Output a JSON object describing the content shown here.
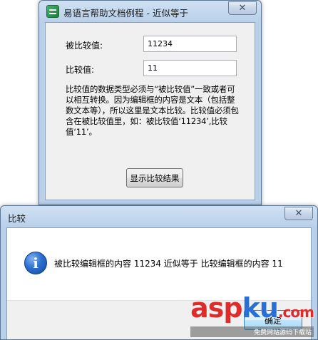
{
  "main_window": {
    "title": "易语言帮助文档例程 - 近似等于",
    "close_glyph": "✕",
    "label_compared": "被比较值:",
    "value_compared": "11234",
    "label_compare": "比较值:",
    "value_compare": "11",
    "description": "比较值的数据类型必须与“被比较值”一致或者可以相互转换。因为编辑框的内容是文本（包括整数文本等），所以这里是文本比较。比较值必须包含在被比较值里，如：被比较值‘11234’,比较值‘11’。",
    "show_result_button": "显示比较结果"
  },
  "message_box": {
    "title": "比较",
    "close_glyph": "✕",
    "icon": "info-icon",
    "icon_glyph": "i",
    "message": "被比较编辑框的内容  11234 近似等于 比较编辑框的内容  11",
    "ok_button": "确定"
  },
  "watermark": {
    "logo_asp": "asp",
    "logo_ku": "ku",
    "logo_tld": ".com",
    "subtitle": "免费网站源码下载站"
  },
  "colors": {
    "frame": "#b9d0ea",
    "client": "#f0f0f0",
    "watermark_red": "#e02b2b",
    "watermark_blue": "#2a6fd6"
  }
}
